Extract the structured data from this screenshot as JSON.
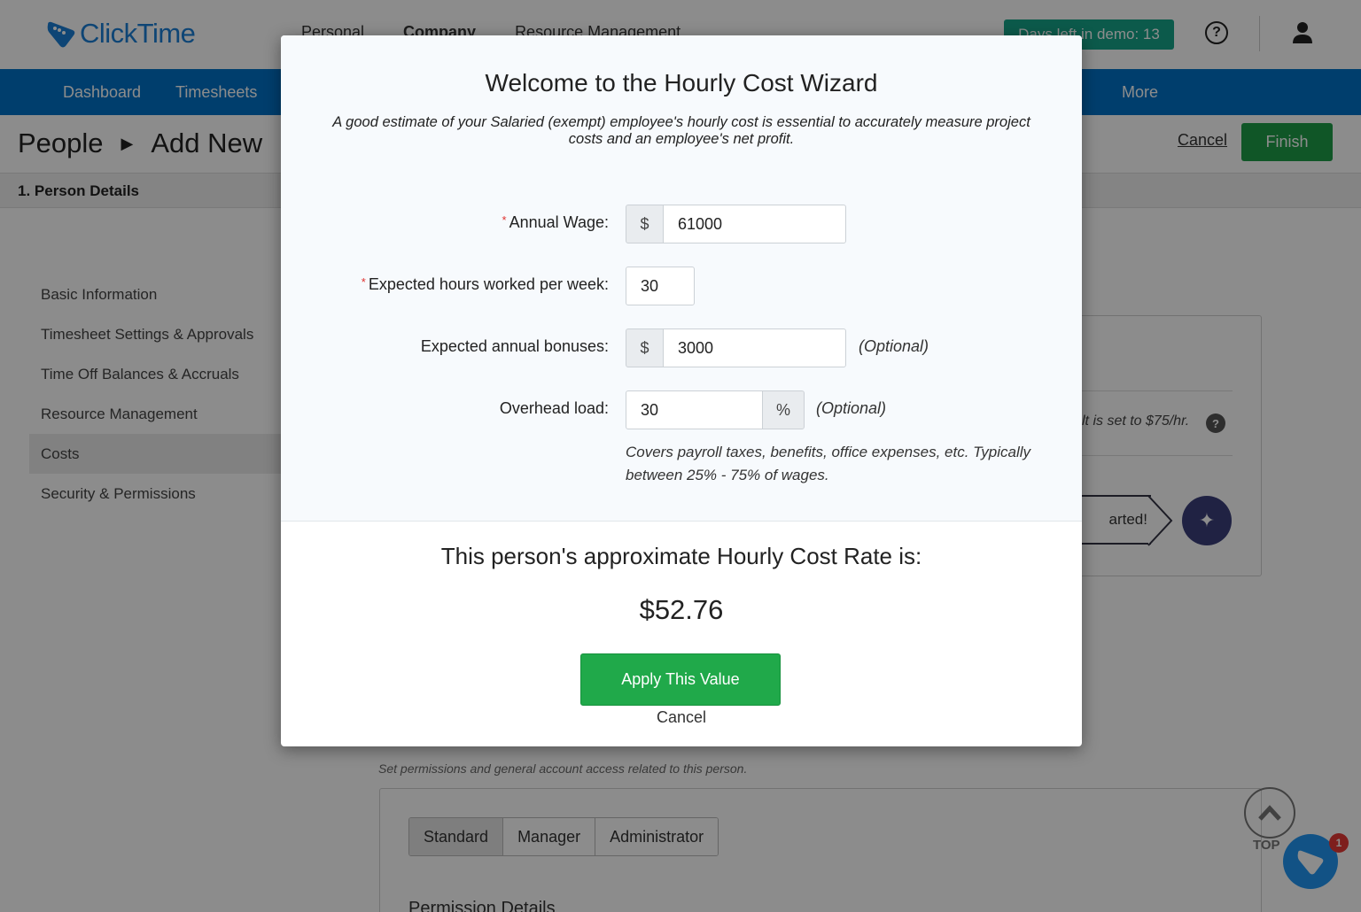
{
  "app": {
    "logo_text": "ClickTime",
    "brand_color": "#1a7fd6"
  },
  "top_nav": [
    "Personal",
    "Company",
    "Resource Management"
  ],
  "demo_badge": "Days left in demo: 13",
  "main_nav": {
    "dashboard": "Dashboard",
    "timesheets": "Timesheets",
    "more": "More"
  },
  "breadcrumb": {
    "root": "People",
    "current": "Add New"
  },
  "header_actions": {
    "cancel": "Cancel",
    "finish": "Finish"
  },
  "step": "1. Person Details",
  "sidebar": {
    "items": [
      {
        "label": "Basic Information"
      },
      {
        "label": "Timesheet Settings & Approvals"
      },
      {
        "label": "Time Off Balances & Accruals"
      },
      {
        "label": "Resource Management"
      },
      {
        "label": "Costs"
      },
      {
        "label": "Security & Permissions"
      }
    ],
    "active_index": 4
  },
  "costs_panel": {
    "hint_partial": "lt is set to $75/hr.",
    "started_partial": "arted!"
  },
  "permissions": {
    "description": "Set permissions and general account access related to this person.",
    "levels": [
      "Standard",
      "Manager",
      "Administrator"
    ],
    "selected": "Standard",
    "details_heading": "Permission Details"
  },
  "scroll_top_label": "TOP",
  "chat": {
    "badge_count": "1"
  },
  "modal": {
    "title": "Welcome to the Hourly Cost Wizard",
    "subtitle": "A good estimate of your Salaried (exempt) employee's hourly cost is essential to accurately measure project costs and an employee's net profit.",
    "fields": {
      "annual_wage": {
        "label": "Annual Wage:",
        "prefix": "$",
        "value": "61000",
        "required": true
      },
      "hours_per_week": {
        "label": "Expected hours worked per week:",
        "value": "30",
        "required": true
      },
      "annual_bonuses": {
        "label": "Expected annual bonuses:",
        "prefix": "$",
        "value": "3000",
        "note": "(Optional)"
      },
      "overhead_load": {
        "label": "Overhead load:",
        "value": "30",
        "suffix": "%",
        "note": "(Optional)"
      }
    },
    "required_marker": "*",
    "overhead_help": "Covers payroll taxes, benefits, office expenses, etc. Typically between 25% - 75% of wages.",
    "result_label": "This person's approximate Hourly Cost Rate is:",
    "result_value": "$52.76",
    "apply_label": "Apply This Value",
    "cancel_label": "Cancel",
    "accent_color": "#20a94a"
  }
}
